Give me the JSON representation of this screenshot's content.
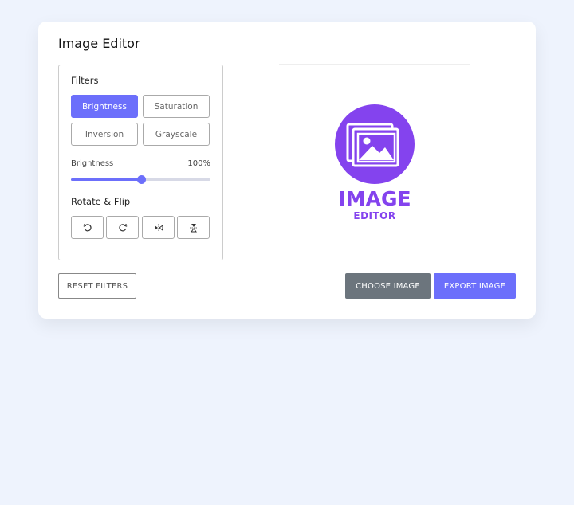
{
  "app": {
    "title": "Image Editor"
  },
  "filters": {
    "heading": "Filters",
    "buttons": [
      {
        "label": "Brightness",
        "active": true
      },
      {
        "label": "Saturation",
        "active": false
      },
      {
        "label": "Inversion",
        "active": false
      },
      {
        "label": "Grayscale",
        "active": false
      }
    ],
    "slider": {
      "name": "Brightness",
      "value": "100%",
      "fraction": 0.5
    }
  },
  "rotate": {
    "heading": "Rotate & Flip",
    "icons": [
      "rotate-left-icon",
      "rotate-right-icon",
      "flip-horizontal-icon",
      "flip-vertical-icon"
    ]
  },
  "preview": {
    "logo_line1": "IMAGE",
    "logo_line2": "EDITOR"
  },
  "actions": {
    "reset": "RESET FILTERS",
    "choose": "CHOOSE IMAGE",
    "export": "EXPORT IMAGE"
  },
  "colors": {
    "accent": "#6c6ffb",
    "logo": "#8443ee",
    "secondary": "#6c757d",
    "background": "#eef3fd"
  }
}
